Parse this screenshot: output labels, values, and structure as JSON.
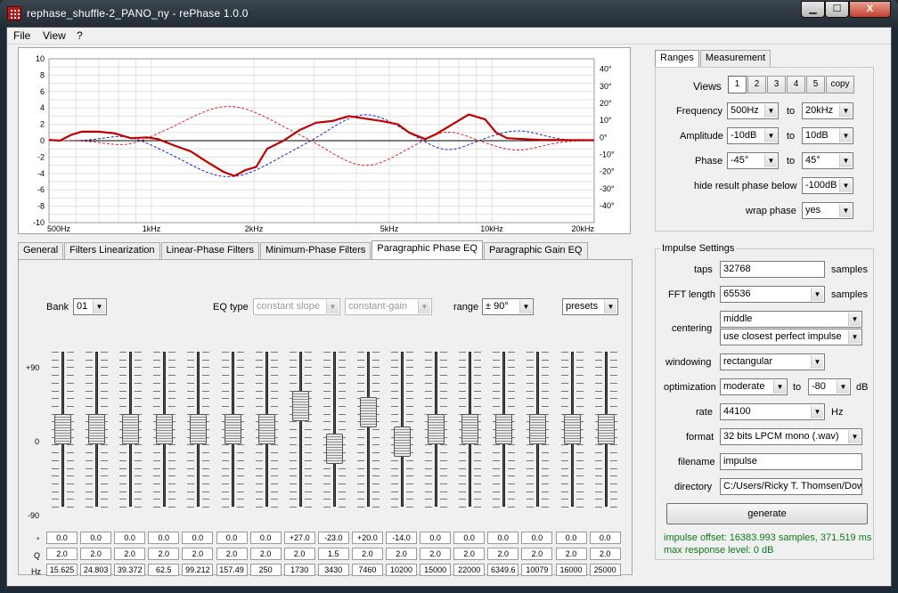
{
  "window": {
    "title": "rephase_shuffle-2_PANO_ny  -  rePhase 1.0.0",
    "minimize": "▁",
    "maximize": "☐",
    "close": "✕",
    "close_hint": "X"
  },
  "menu": [
    "File",
    "View",
    "?"
  ],
  "graph": {
    "left_ticks": [
      "10",
      "8",
      "6",
      "4",
      "2",
      "0",
      "-2",
      "-4",
      "-6",
      "-8",
      "-10"
    ],
    "right_ticks": [
      "40°",
      "30°",
      "20°",
      "10°",
      "0°",
      "-10°",
      "-20°",
      "-30°",
      "-40°"
    ],
    "x_ticks": [
      "500Hz",
      "1kHz",
      "2kHz",
      "5kHz",
      "10kHz",
      "20kHz"
    ],
    "colors": {
      "magnitude": "#c00000",
      "phase_blue": "#2222cc",
      "phase_red": "#dd2222",
      "grid": "#e0e0e0"
    }
  },
  "tabs": [
    "General",
    "Filters Linearization",
    "Linear-Phase Filters",
    "Minimum-Phase Filters",
    "Paragraphic Phase EQ",
    "Paragraphic Gain EQ"
  ],
  "active_tab": "Paragraphic Phase EQ",
  "eq": {
    "bank_label": "Bank",
    "bank_value": "01",
    "eqtype_label": "EQ type",
    "eqtype_value": "constant slope",
    "gain_value": "constant-gain",
    "range_label": "range",
    "range_value": "± 90°",
    "presets_label": "presets",
    "scale": [
      "+90",
      "0",
      "-90"
    ],
    "row_labels": [
      "°",
      "Q",
      "Hz"
    ],
    "bands": [
      {
        "deg": "0.0",
        "q": "2.0",
        "hz": "15.625"
      },
      {
        "deg": "0.0",
        "q": "2.0",
        "hz": "24.803"
      },
      {
        "deg": "0.0",
        "q": "2.0",
        "hz": "39.372"
      },
      {
        "deg": "0.0",
        "q": "2.0",
        "hz": "62.5"
      },
      {
        "deg": "0.0",
        "q": "2.0",
        "hz": "99.212"
      },
      {
        "deg": "0.0",
        "q": "2.0",
        "hz": "157.49"
      },
      {
        "deg": "0.0",
        "q": "2.0",
        "hz": "250"
      },
      {
        "deg": "+27.0",
        "q": "2.0",
        "hz": "1730"
      },
      {
        "deg": "-23.0",
        "q": "1.5",
        "hz": "3430"
      },
      {
        "deg": "+20.0",
        "q": "2.0",
        "hz": "7460"
      },
      {
        "deg": "-14.0",
        "q": "2.0",
        "hz": "10200"
      },
      {
        "deg": "0.0",
        "q": "2.0",
        "hz": "15000"
      },
      {
        "deg": "0.0",
        "q": "2.0",
        "hz": "22000"
      },
      {
        "deg": "0.0",
        "q": "2.0",
        "hz": "6349.6"
      },
      {
        "deg": "0.0",
        "q": "2.0",
        "hz": "10079"
      },
      {
        "deg": "0.0",
        "q": "2.0",
        "hz": "16000"
      },
      {
        "deg": "0.0",
        "q": "2.0",
        "hz": "25000"
      }
    ]
  },
  "ranges": {
    "tabs": [
      "Ranges",
      "Measurement"
    ],
    "views_label": "Views",
    "views": [
      "1",
      "2",
      "3",
      "4",
      "5",
      "copy"
    ],
    "frequency_label": "Frequency",
    "freq_from": "500Hz",
    "freq_to": "20kHz",
    "amplitude_label": "Amplitude",
    "amp_from": "-10dB",
    "amp_to": "10dB",
    "phase_label": "Phase",
    "phase_from": "-45°",
    "phase_to": "45°",
    "to": "to",
    "hide_label": "hide result phase below",
    "hide_value": "-100dB",
    "wrap_label": "wrap phase",
    "wrap_value": "yes"
  },
  "impulse": {
    "title": "Impulse Settings",
    "taps_label": "taps",
    "taps": "32768",
    "samples": "samples",
    "fft_label": "FFT length",
    "fft": "65536",
    "centering_label": "centering",
    "centering": "middle",
    "centering2": "use closest perfect impulse",
    "windowing_label": "windowing",
    "windowing": "rectangular",
    "optimization_label": "optimization",
    "optimization": "moderate",
    "opt_to": "to",
    "opt_db": "-80",
    "db": "dB",
    "rate_label": "rate",
    "rate": "44100",
    "hz": "Hz",
    "format_label": "format",
    "format": "32 bits LPCM mono (.wav)",
    "filename_label": "filename",
    "filename": "impulse",
    "directory_label": "directory",
    "directory": "C:/Users/Ricky T. Thomsen/Dow",
    "generate": "generate",
    "status1": "impulse offset: 16383.993 samples, 371.519 ms",
    "status2": "max response level: 0 dB"
  }
}
